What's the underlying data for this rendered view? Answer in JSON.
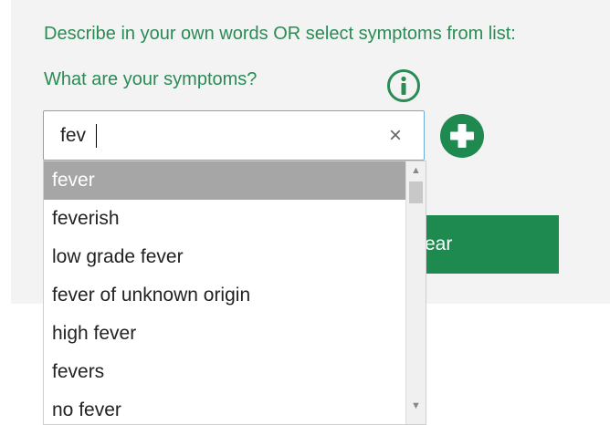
{
  "instruction": "Describe in your own words OR select symptoms from list:",
  "question": "What are your symptoms?",
  "search": {
    "value": "fev",
    "clear_icon": "close-icon"
  },
  "buttons": {
    "clear_label": "ear"
  },
  "icons": {
    "info": "info-icon",
    "add": "plus-icon"
  },
  "suggestions": [
    "fever",
    "feverish",
    "low grade fever",
    "fever of unknown origin",
    "high fever",
    "fevers",
    "no fever"
  ],
  "selected_index": 0,
  "colors": {
    "accent": "#2a8b55",
    "button": "#1f8a50",
    "selected_row": "#a6a6a6"
  }
}
